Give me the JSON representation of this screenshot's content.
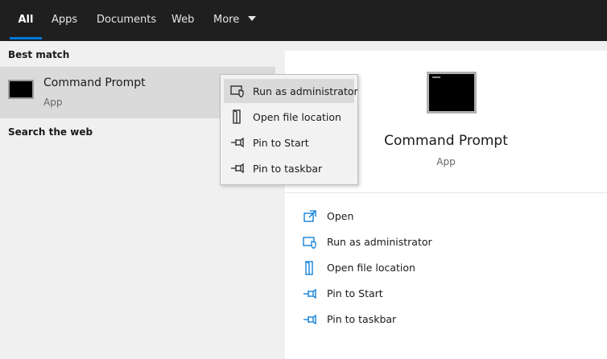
{
  "tabs": [
    {
      "label": "All",
      "active": true
    },
    {
      "label": "Apps"
    },
    {
      "label": "Documents"
    },
    {
      "label": "Web"
    },
    {
      "label": "More"
    }
  ],
  "left": {
    "best_match_header": "Best match",
    "result": {
      "title": "Command Prompt",
      "subtitle": "App",
      "icon": "terminal-icon"
    },
    "search_web_header": "Search the web"
  },
  "preview": {
    "title": "Command Prompt",
    "subtitle": "App",
    "actions": [
      {
        "label": "Open",
        "icon": "open-icon"
      },
      {
        "label": "Run as administrator",
        "icon": "shield-icon"
      },
      {
        "label": "Open file location",
        "icon": "file-location-icon"
      },
      {
        "label": "Pin to Start",
        "icon": "pin-icon"
      },
      {
        "label": "Pin to taskbar",
        "icon": "pin-icon"
      }
    ]
  },
  "context_menu": {
    "items": [
      {
        "label": "Run as administrator",
        "icon": "shield-icon",
        "hovered": true
      },
      {
        "label": "Open file location",
        "icon": "file-location-icon"
      },
      {
        "label": "Pin to Start",
        "icon": "pin-icon"
      },
      {
        "label": "Pin to taskbar",
        "icon": "pin-icon"
      }
    ]
  },
  "colors": {
    "accent": "#0078d7",
    "tabbar": "#1f1f1f",
    "selected_row": "#dadada",
    "preview_bg": "#ffffff"
  }
}
